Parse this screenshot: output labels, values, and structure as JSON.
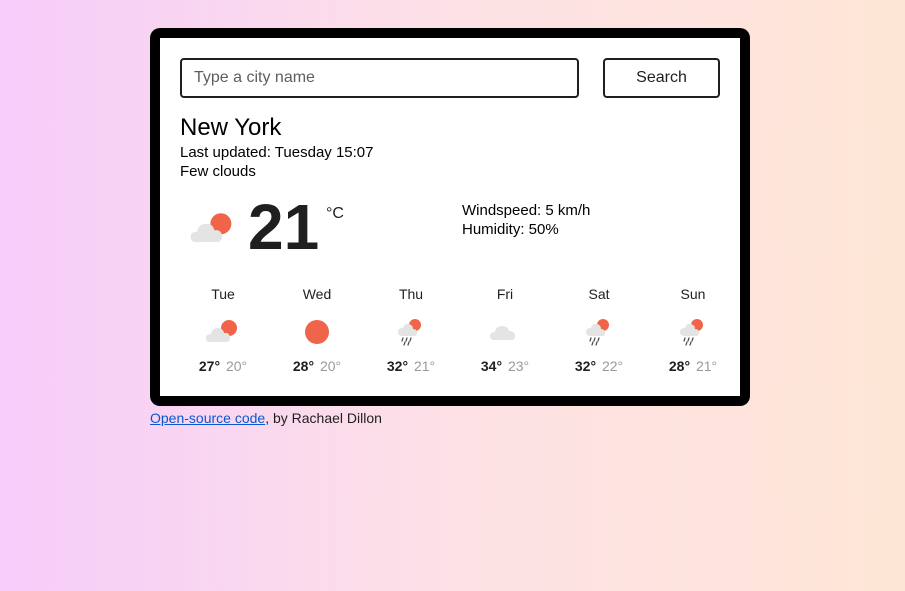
{
  "search": {
    "placeholder": "Type a city name",
    "button_label": "Search"
  },
  "current": {
    "city": "New York",
    "last_updated": "Last updated: Tuesday 15:07",
    "description": "Few clouds",
    "icon": "few-clouds-icon",
    "temperature": "21",
    "unit": "°C",
    "windspeed": "Windspeed: 5 km/h",
    "humidity": "Humidity: 50%"
  },
  "forecast": [
    {
      "day": "Tue",
      "icon": "few-clouds-icon",
      "max": "27°",
      "min": "20°"
    },
    {
      "day": "Wed",
      "icon": "clear-sky-icon",
      "max": "28°",
      "min": "20°"
    },
    {
      "day": "Thu",
      "icon": "rain-icon",
      "max": "32°",
      "min": "21°"
    },
    {
      "day": "Fri",
      "icon": "cloud-icon",
      "max": "34°",
      "min": "23°"
    },
    {
      "day": "Sat",
      "icon": "rain-icon",
      "max": "32°",
      "min": "22°"
    },
    {
      "day": "Sun",
      "icon": "rain-icon",
      "max": "28°",
      "min": "21°"
    }
  ],
  "footer": {
    "link_text": "Open-source code",
    "suffix": ", by Rachael Dillon"
  },
  "colors": {
    "sun": "#f0654a",
    "cloud": "#e4e4e4",
    "rain": "#4a4a4a",
    "frame": "#000000"
  }
}
